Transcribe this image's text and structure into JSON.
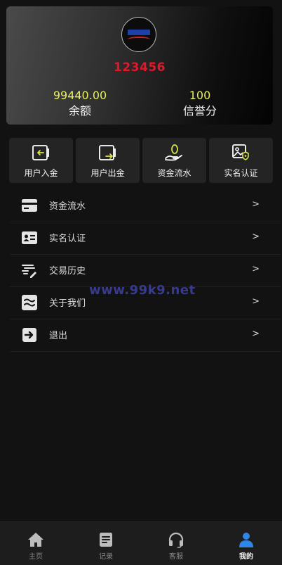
{
  "profile": {
    "username": "123456",
    "balance": "99440.00",
    "balance_label": "余额",
    "credit": "100",
    "credit_label": "信誉分"
  },
  "quick_actions": [
    {
      "label": "用户入金",
      "icon": "wallet-in-icon"
    },
    {
      "label": "用户出金",
      "icon": "wallet-out-icon"
    },
    {
      "label": "资金流水",
      "icon": "money-hand-icon"
    },
    {
      "label": "实名认证",
      "icon": "id-verify-icon"
    }
  ],
  "menu": [
    {
      "label": "资金流水",
      "icon": "card-icon",
      "chevron": ">"
    },
    {
      "label": "实名认证",
      "icon": "id-card-icon",
      "chevron": ">"
    },
    {
      "label": "交易历史",
      "icon": "history-icon",
      "chevron": ">"
    },
    {
      "label": "关于我们",
      "icon": "about-icon",
      "chevron": ">"
    },
    {
      "label": "退出",
      "icon": "logout-icon",
      "chevron": ">"
    }
  ],
  "watermark": "www.99k9.net",
  "tabs": [
    {
      "label": "主页",
      "icon": "home-icon",
      "active": false
    },
    {
      "label": "记录",
      "icon": "records-icon",
      "active": false
    },
    {
      "label": "客服",
      "icon": "headset-icon",
      "active": false
    },
    {
      "label": "我的",
      "icon": "user-icon",
      "active": true
    }
  ],
  "colors": {
    "username": "#e2182a",
    "stat_value": "#e7ef5a",
    "icon_accent": "#d9e34a",
    "active_tab": "#2f86e8"
  }
}
